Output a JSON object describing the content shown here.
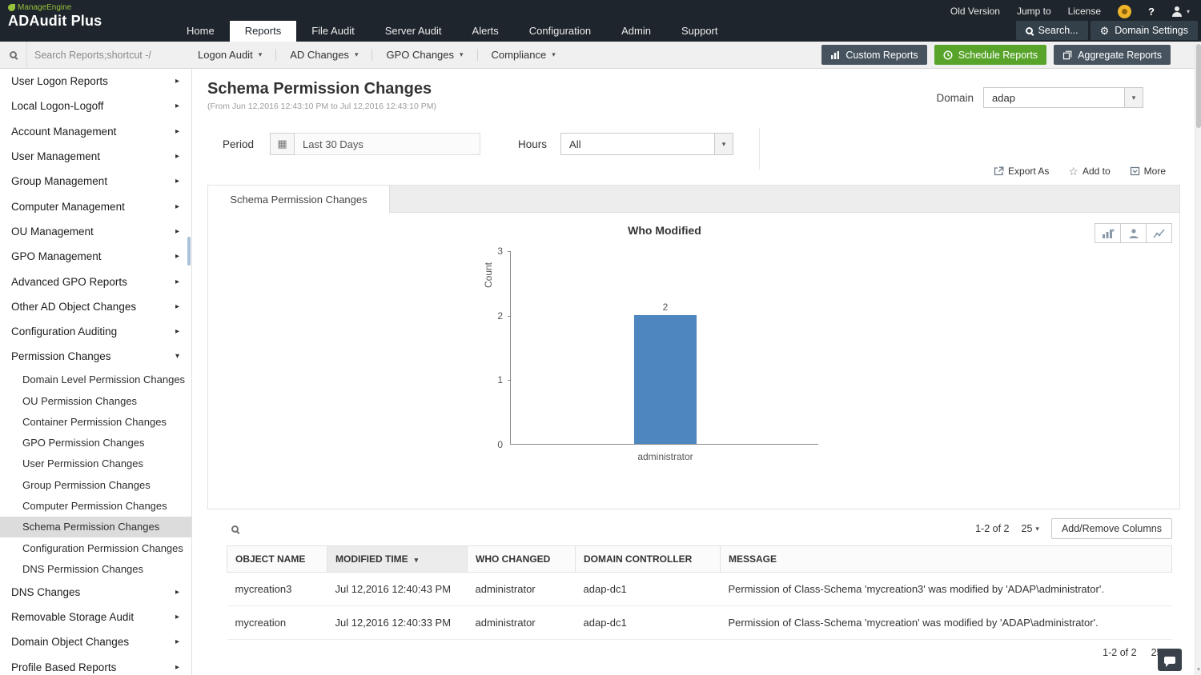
{
  "header": {
    "company": "ManageEngine",
    "product": "ADAudit Plus",
    "utility": [
      "Old Version",
      "Jump to",
      "License"
    ],
    "tabs": [
      "Home",
      "Reports",
      "File Audit",
      "Server Audit",
      "Alerts",
      "Configuration",
      "Admin",
      "Support"
    ],
    "active_tab": "Reports",
    "search_label": "Search...",
    "domain_settings_label": "Domain Settings"
  },
  "toolbar": {
    "search_placeholder": "Search Reports;shortcut -/",
    "menus": [
      "Logon Audit",
      "AD Changes",
      "GPO Changes",
      "Compliance"
    ],
    "custom_reports": "Custom Reports",
    "schedule_reports": "Schedule Reports",
    "aggregate_reports": "Aggregate Reports"
  },
  "sidebar": {
    "items_top": [
      "User Logon Reports",
      "Local Logon-Logoff",
      "Account Management",
      "User Management",
      "Group Management",
      "Computer Management",
      "OU Management",
      "GPO Management",
      "Advanced GPO Reports",
      "Other AD Object Changes",
      "Configuration Auditing"
    ],
    "expanded_item": "Permission Changes",
    "sub_items": [
      "Domain Level Permission Changes",
      "OU Permission Changes",
      "Container Permission Changes",
      "GPO Permission Changes",
      "User Permission Changes",
      "Group Permission Changes",
      "Computer Permission Changes",
      "Schema Permission Changes",
      "Configuration Permission Changes",
      "DNS Permission Changes"
    ],
    "selected_sub_item": "Schema Permission Changes",
    "items_bottom": [
      "DNS Changes",
      "Removable Storage Audit",
      "Domain Object Changes",
      "Profile Based Reports"
    ]
  },
  "page": {
    "title": "Schema Permission Changes",
    "date_range": "(From Jun 12,2016 12:43:10 PM to Jul 12,2016 12:43:10 PM)",
    "domain_label": "Domain",
    "domain_value": "adap",
    "period_label": "Period",
    "period_value": "Last 30 Days",
    "hours_label": "Hours",
    "hours_value": "All",
    "export_as": "Export As",
    "add_to": "Add to",
    "more": "More",
    "report_tab": "Schema Permission Changes"
  },
  "chart_data": {
    "type": "bar",
    "title": "Who Modified",
    "categories": [
      "administrator"
    ],
    "values": [
      2
    ],
    "xlabel": "",
    "ylabel": "Count",
    "ylim": [
      0,
      3
    ],
    "yticks": [
      0,
      1,
      2,
      3
    ],
    "grid": false,
    "legend": "none",
    "bar_color": "#4e86c0"
  },
  "table": {
    "headers": [
      "OBJECT NAME",
      "MODIFIED TIME",
      "WHO CHANGED",
      "DOMAIN CONTROLLER",
      "MESSAGE"
    ],
    "sorted_by": "MODIFIED TIME",
    "sort_direction": "desc",
    "rows": [
      {
        "object_name": "mycreation3",
        "modified_time": "Jul 12,2016 12:40:43 PM",
        "who_changed": "administrator",
        "domain_controller": "adap-dc1",
        "message": "Permission of Class-Schema 'mycreation3' was modified by 'ADAP\\administrator'."
      },
      {
        "object_name": "mycreation",
        "modified_time": "Jul 12,2016 12:40:33 PM",
        "who_changed": "administrator",
        "domain_controller": "adap-dc1",
        "message": "Permission of Class-Schema 'mycreation' was modified by 'ADAP\\administrator'."
      }
    ],
    "range_label": "1-2 of 2",
    "page_size": "25",
    "add_remove_columns": "Add/Remove Columns",
    "range_label_bottom": "1-2 of 2",
    "page_size_bottom": "25"
  },
  "colors": {
    "header_bg": "#1e252c",
    "accent_green": "#58a42a",
    "button_dark": "#47545f",
    "bar_blue": "#4e86c0"
  },
  "icons": {
    "caret_down": "▾",
    "caret_up": "▴",
    "chevron_right": "▸",
    "gear": "⚙",
    "calendar": "▦",
    "star": "☆",
    "help": "?"
  }
}
